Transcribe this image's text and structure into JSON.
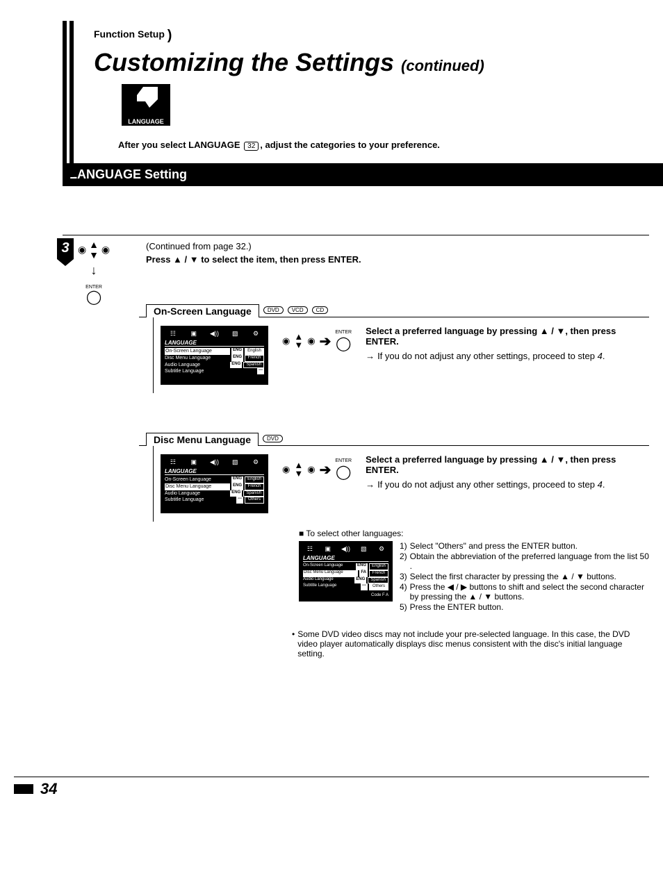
{
  "header": {
    "breadcrumb": "Function Setup",
    "title": "Customizing the Settings",
    "title_suffix": "(continued)",
    "icon_label": "LANGUAGE",
    "intro_pre": "After you select LANGUAGE ",
    "intro_ref": "32",
    "intro_post": ", adjust the categories to your preference.",
    "band": "LANGUAGE Setting"
  },
  "step": {
    "num": "3",
    "continued": "(Continued from page 32.)",
    "instruction": "Press ▲ / ▼ to select the item, then press ENTER.",
    "enter_label": "ENTER"
  },
  "on_screen": {
    "title": "On-Screen Language",
    "discs": [
      "DVD",
      "VCD",
      "CD"
    ],
    "menu": {
      "title": "LANGUAGE",
      "rows": [
        {
          "label": "On-Screen Language",
          "code": "ENG",
          "val": "English",
          "hl": true,
          "valhl": true
        },
        {
          "label": "Disc Menu Language",
          "code": "ENG",
          "val": "French",
          "hl": false,
          "valhl": false
        },
        {
          "label": "Audio Language",
          "code": "ENG",
          "val": "Spanish",
          "hl": false,
          "valhl": false
        },
        {
          "label": "Subtitle Language",
          "code": "---",
          "val": "",
          "hl": false,
          "valhl": false
        }
      ]
    },
    "text_bold": "Select a preferred language by pressing ▲ / ▼, then press ENTER.",
    "text_sub": "If you do not adjust any other settings, proceed to step ",
    "text_step": "4",
    "text_sub_end": "."
  },
  "disc_menu": {
    "title": "Disc Menu Language",
    "discs": [
      "DVD"
    ],
    "menu": {
      "title": "LANGUAGE",
      "rows": [
        {
          "label": "On-Screen Language",
          "code": "ENG",
          "val": "English",
          "hl": false,
          "valhl": false
        },
        {
          "label": "Disc Menu Language",
          "code": "ENG",
          "val": "French",
          "hl": true,
          "valhl": false
        },
        {
          "label": "Audio Language",
          "code": "ENG",
          "val": "Spanish",
          "hl": false,
          "valhl": false
        },
        {
          "label": "Subtitle Language",
          "code": "---",
          "val": "Others",
          "hl": false,
          "valhl": false
        }
      ]
    },
    "text_bold": "Select a preferred language by pressing ▲ / ▼, then press ENTER.",
    "text_sub": "If you do not adjust any other settings, proceed to step ",
    "text_step": "4",
    "text_sub_end": ".",
    "other_title": "To select other languages:",
    "other_menu": {
      "title": "LANGUAGE",
      "rows": [
        {
          "label": "On-Screen Language",
          "code": "ENG",
          "val": "English"
        },
        {
          "label": "Disc Menu Language",
          "code": "FA",
          "val": "French"
        },
        {
          "label": "Audio Language",
          "code": "ENG",
          "val": "Spanish"
        },
        {
          "label": "Subtitle Language",
          "code": "---",
          "val": "Others"
        }
      ],
      "code_ind": "Code   F A"
    },
    "other_steps": [
      "Select \"Others\" and press the ENTER button.",
      "Obtain the abbreviation of the preferred language from the list  50 .",
      "Select the first character by pressing the ▲ / ▼ buttons.",
      "Press the ◀ / ▶ buttons to shift and select the second character by pressing the ▲ / ▼ buttons.",
      "Press the ENTER button."
    ]
  },
  "note": "Some DVD video discs may not include your pre-selected language. In this case, the DVD video player automatically displays disc menus consistent with the disc's initial language setting.",
  "page_number": "34"
}
